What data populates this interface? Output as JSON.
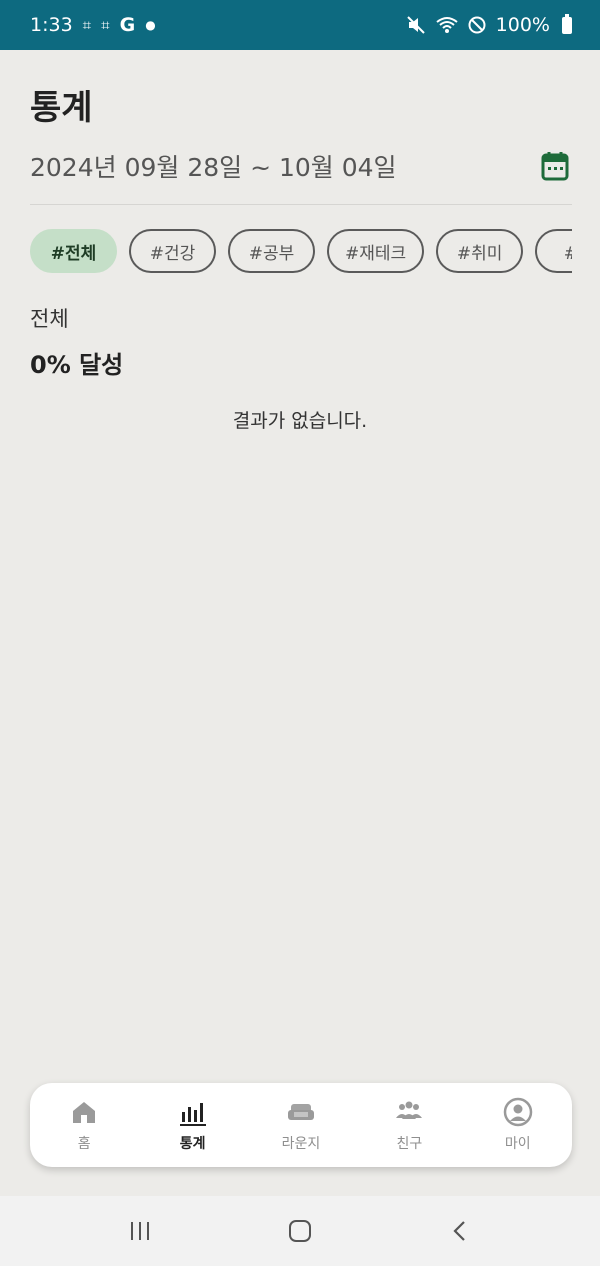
{
  "status_bar": {
    "time": "1:33",
    "icons_left": [
      "screenshot-icon",
      "screenshot-icon",
      "google-icon",
      "dot"
    ],
    "g_letter": "G",
    "battery": "100%",
    "icons_right": [
      "mute-icon",
      "wifi-icon",
      "do-not-disturb-icon",
      "battery-icon"
    ]
  },
  "header": {
    "title": "통계",
    "date_range": "2024년 09월 28일 ~ 10월 04일",
    "calendar_icon": "calendar-icon"
  },
  "filters": {
    "chips": [
      {
        "label": "#전체",
        "active": true
      },
      {
        "label": "#건강",
        "active": false
      },
      {
        "label": "#공부",
        "active": false
      },
      {
        "label": "#재테크",
        "active": false
      },
      {
        "label": "#취미",
        "active": false
      },
      {
        "label": "#독",
        "active": false
      }
    ]
  },
  "summary": {
    "category": "전체",
    "achievement": "0% 달성",
    "empty_message": "결과가 없습니다."
  },
  "bottom_nav": {
    "items": [
      {
        "label": "홈",
        "icon": "home-icon",
        "active": false
      },
      {
        "label": "통계",
        "icon": "bar-chart-icon",
        "active": true
      },
      {
        "label": "라운지",
        "icon": "sofa-icon",
        "active": false
      },
      {
        "label": "친구",
        "icon": "people-icon",
        "active": false
      },
      {
        "label": "마이",
        "icon": "profile-icon",
        "active": false
      }
    ]
  },
  "colors": {
    "status_bar": "#0d6a80",
    "background": "#ecebe8",
    "accent_green": "#1e6b3a",
    "active_chip": "#c5dfc8"
  }
}
